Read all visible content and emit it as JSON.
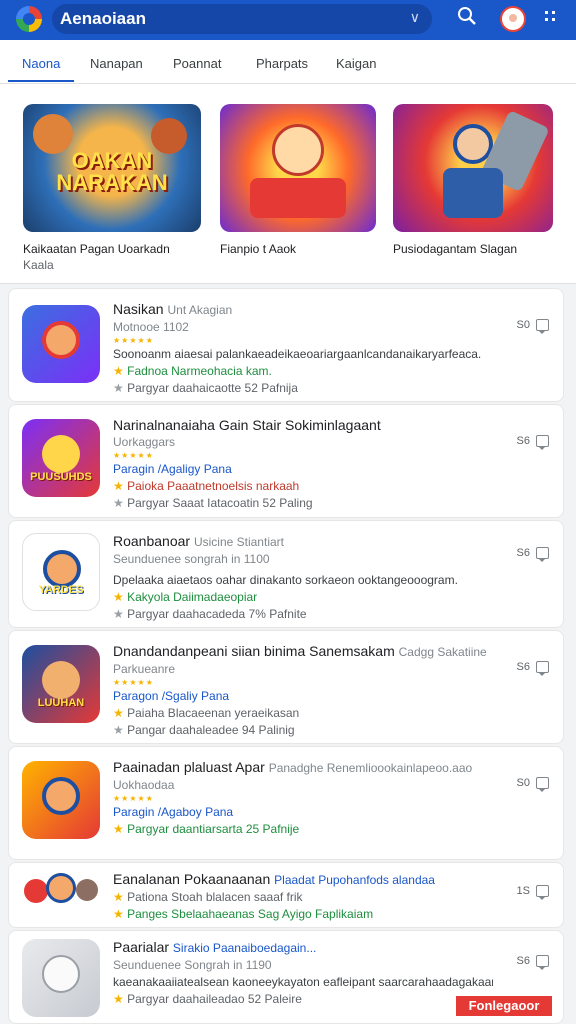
{
  "header": {
    "search_text": "Aenaoiaan",
    "icons": [
      "app-logo-icon",
      "dropdown-chevron-icon",
      "search-icon",
      "profile-avatar-icon",
      "menu-grid-icon"
    ]
  },
  "tabs": [
    {
      "label": "Naona",
      "active": true
    },
    {
      "label": "Nanapan"
    },
    {
      "label": "Poannat"
    },
    {
      "label": "Pharpats"
    },
    {
      "label": "Kaigan"
    }
  ],
  "featured": [
    {
      "caption_line1": "Kaikaatan Pagan Uoarkadn",
      "caption_line2": "Kaala",
      "art_line1": "OAKAN",
      "art_line2": "NARAKAN"
    },
    {
      "caption_line1": "Fianpio t Aaok",
      "caption_line2": ""
    },
    {
      "caption_line1": "Pusiodagantam Slagan",
      "caption_line2": ""
    }
  ],
  "apps": [
    {
      "name": "Nasikan",
      "name_extra": "Unt Akagian",
      "line2": "Motnooe 1102",
      "line3": "Soonoanm aiaesai palankaeadeikaeoariargaanlcandanaikaryarfeaca.",
      "line4": "Fadnoa Narmeohacia kam.",
      "line5": "Pargyar daahaicaotte 52 Pafnija",
      "side_count": "S0",
      "icon_label": ""
    },
    {
      "name": "Narinalnanaiaha Gain Stair Sokiminlagaant",
      "name_extra": "",
      "line2": "Uorkaggars",
      "line3": "Paragin /Agaligy Pana",
      "line4": "Paioka Paaatnetnoelsis narkaah",
      "line5": "Pargyar Saaat Iatacoatin 52 Paling",
      "side_count": "S6",
      "icon_label": "PUUSUHDS"
    },
    {
      "name": "Roanbanoar",
      "name_extra": "Usicine Stiantiart",
      "line2": "Seunduenee songrah in 1100",
      "line3": "Dpelaaka aiaetaos oahar dinakanto sorkaeon  ooktangeooogram.",
      "line4": "Kakyola Daiimadaeopiar",
      "line5": "Pargyar daahacadeda 7% Pafnite",
      "side_count": "S6",
      "icon_label": "YARDES"
    },
    {
      "name": "Dnandandanpeani siian binima Sanemsakam",
      "name_extra": "Cadgg Sakatiine",
      "line2": "Parkueanre",
      "line3": "Paragon /Sgaliy Pana",
      "line4": "Paiaha Blacaeenan yeraeikasan",
      "line5": "Pangar daahaleadee 94 Palinig",
      "side_count": "S6",
      "icon_label": "LUUHAN"
    },
    {
      "name": "Paainadan plaluast Apar",
      "name_extra": "Panadghe Renemlioookainlapeoo.aao",
      "line2": "Uokhaodaa",
      "line3": "Paragin /Agaboy Pana",
      "line4": "Pargyar daantiarsarta 25 Pafnije",
      "line5": "",
      "side_count": "S0",
      "icon_label": ""
    },
    {
      "name": "Eanalanan Pokaanaanan",
      "name_extra": "Plaadat Pupohanfods alandaa",
      "line2": "Pationa Stoah blalacen saaaf frik",
      "line3": "Panges Sbelaahaeanas Sag Ayigo Faplikaiam",
      "line4": "",
      "line5": "",
      "side_count": "1S",
      "icon_label": ""
    },
    {
      "name": "Paarialar",
      "name_extra": "Sirakio Paanaiboedagain...",
      "line2": "Seunduenee Songrah in 1190",
      "line3": "kaeanakaaiiatealsean kaoneeykayaton eafleipant saarcarahaadagakaanima",
      "line4": "Pargyar daahaileadao 52 Paleire",
      "line5": "",
      "side_count": "S6",
      "icon_label": ""
    }
  ],
  "ribbon": "Fonlegaoor",
  "colors": {
    "header": "#1a57c9",
    "accent_green": "#1e8e3e",
    "star": "#f4b400",
    "ribbon": "#e53935"
  }
}
